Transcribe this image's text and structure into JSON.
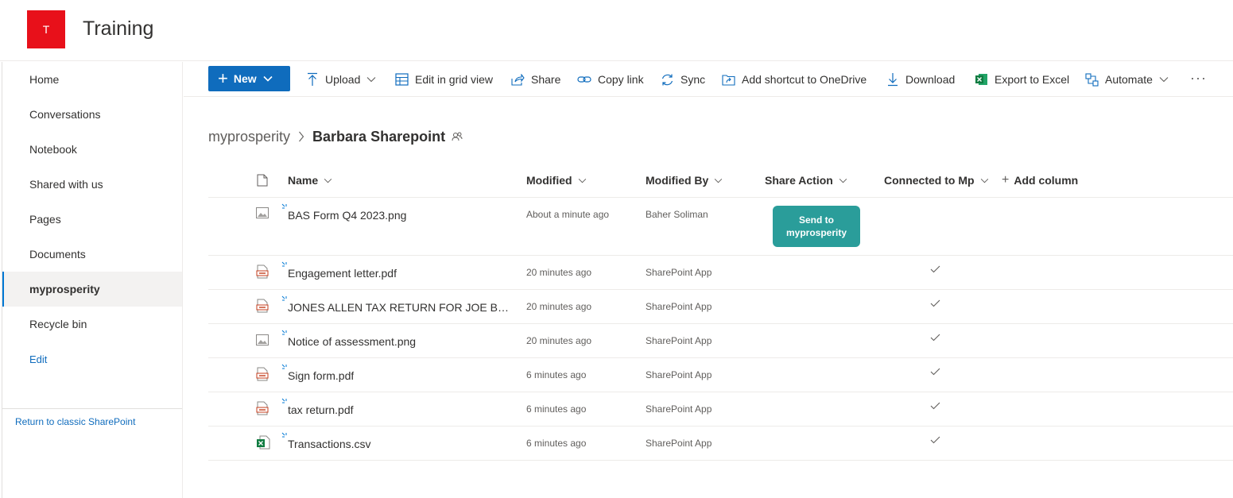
{
  "site": {
    "logo_letter": "T",
    "logo_color": "#e8101a",
    "title": "Training"
  },
  "nav": {
    "items": [
      {
        "label": "Home"
      },
      {
        "label": "Conversations"
      },
      {
        "label": "Notebook"
      },
      {
        "label": "Shared with us"
      },
      {
        "label": "Pages"
      },
      {
        "label": "Documents"
      },
      {
        "label": "myprosperity",
        "active": true
      },
      {
        "label": "Recycle bin"
      }
    ],
    "edit_label": "Edit",
    "return_label": "Return to classic SharePoint"
  },
  "commandbar": {
    "new_label": "New",
    "upload_label": "Upload",
    "grid_label": "Edit in grid view",
    "share_label": "Share",
    "copylink_label": "Copy link",
    "sync_label": "Sync",
    "shortcut_label": "Add shortcut to OneDrive",
    "download_label": "Download",
    "excel_label": "Export to Excel",
    "automate_label": "Automate",
    "more_label": "···",
    "accent_color": "#0f6cbd"
  },
  "breadcrumb": {
    "parent": "myprosperity",
    "current": "Barbara Sharepoint"
  },
  "table": {
    "columns": {
      "name": "Name",
      "modified": "Modified",
      "modified_by": "Modified By",
      "share_action": "Share Action",
      "connected": "Connected to Mp",
      "add_column": "Add column"
    },
    "send_button_label": "Send to myprosperity",
    "send_button_color": "#2a9d9a",
    "rows": [
      {
        "name": "BAS Form Q4 2023.png",
        "icon": "image-file-icon",
        "modified": "About a minute ago",
        "modified_by": "Baher Soliman",
        "send_button": true,
        "connected": false
      },
      {
        "name": "Engagement letter.pdf",
        "icon": "pdf-file-icon",
        "modified": "20 minutes ago",
        "modified_by": "SharePoint App",
        "connected": true
      },
      {
        "name": "JONES ALLEN TAX RETURN FOR JOE BLOGGS.pdf",
        "icon": "pdf-file-icon",
        "modified": "20 minutes ago",
        "modified_by": "SharePoint App",
        "connected": true
      },
      {
        "name": "Notice of assessment.png",
        "icon": "image-file-icon",
        "modified": "20 minutes ago",
        "modified_by": "SharePoint App",
        "connected": true
      },
      {
        "name": "Sign form.pdf",
        "icon": "pdf-file-icon",
        "modified": "6 minutes ago",
        "modified_by": "SharePoint App",
        "connected": true
      },
      {
        "name": "tax return.pdf",
        "icon": "pdf-file-icon",
        "modified": "6 minutes ago",
        "modified_by": "SharePoint App",
        "connected": true
      },
      {
        "name": "Transactions.csv",
        "icon": "excel-file-icon",
        "modified": "6 minutes ago",
        "modified_by": "SharePoint App",
        "connected": true
      }
    ]
  }
}
